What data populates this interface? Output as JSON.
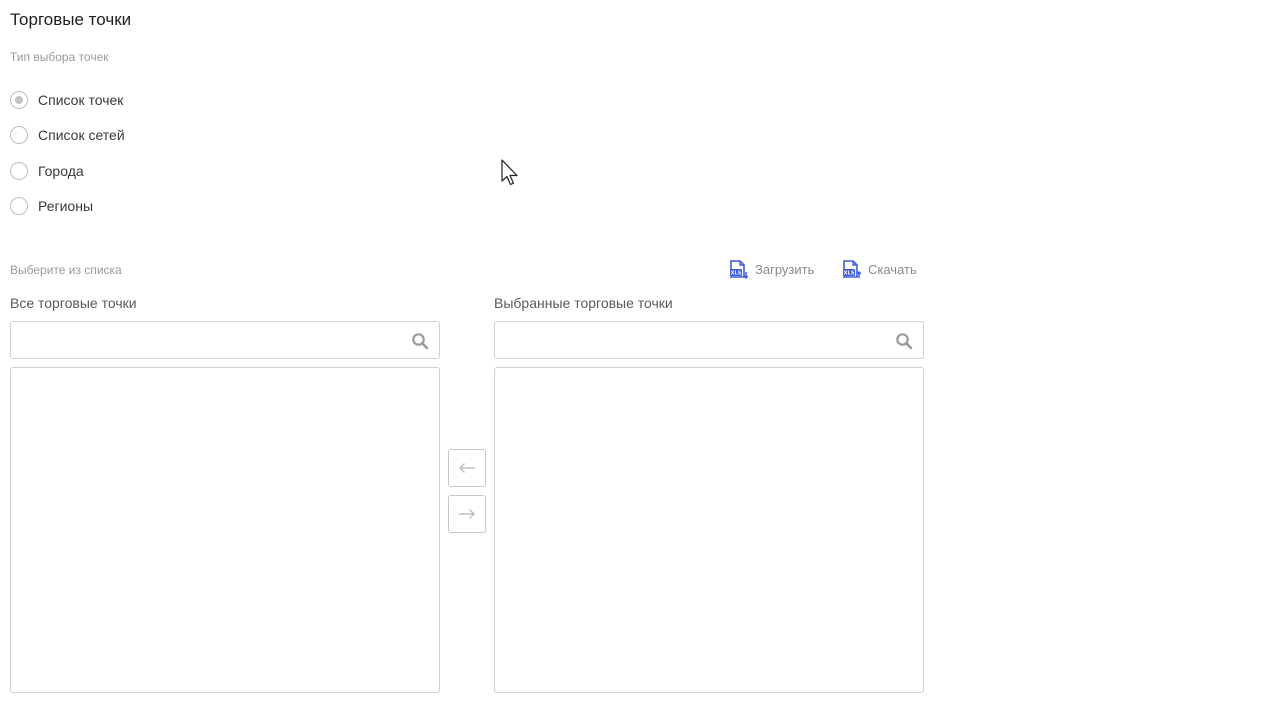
{
  "page": {
    "title": "Торговые точки"
  },
  "selection_type": {
    "caption": "Тип выбора точек",
    "options": [
      {
        "label": "Список точек",
        "checked": true
      },
      {
        "label": "Список сетей",
        "checked": false
      },
      {
        "label": "Города",
        "checked": false
      },
      {
        "label": "Регионы",
        "checked": false
      }
    ]
  },
  "picker": {
    "caption": "Выберите из списка",
    "upload_label": "Загрузить",
    "download_label": "Скачать",
    "file_icon_text": "XLS",
    "all_points": {
      "title": "Все торговые точки",
      "search_value": "",
      "items": []
    },
    "selected_points": {
      "title": "Выбранные торговые точки",
      "search_value": "",
      "items": []
    },
    "move_left_icon": "arrow-left-icon",
    "move_right_icon": "arrow-right-icon"
  },
  "colors": {
    "accent": "#3b5bdb",
    "border": "#d0d0d0",
    "muted_text": "#9a9a9a"
  }
}
